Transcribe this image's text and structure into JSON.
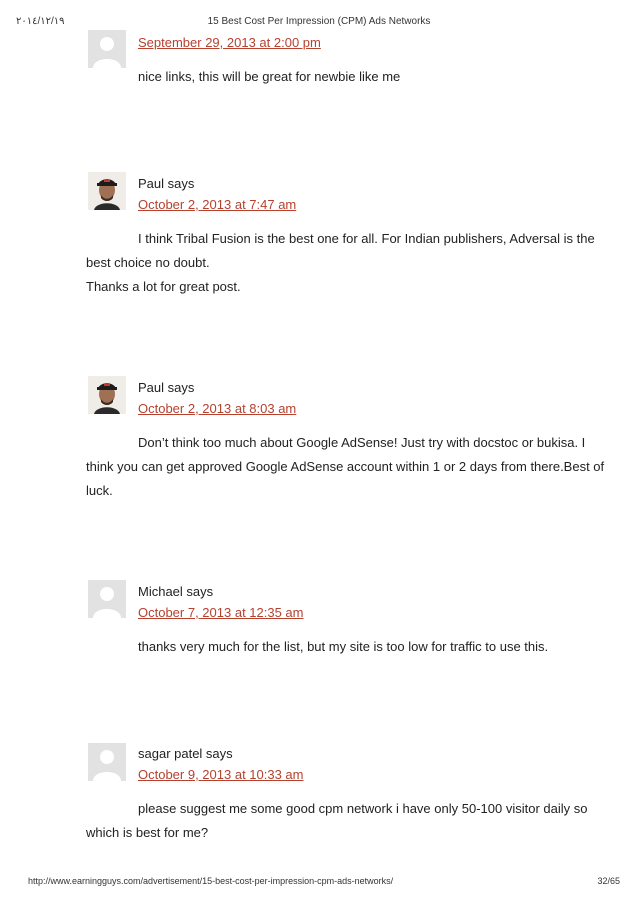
{
  "header": {
    "date": "٢٠١٤/١٢/١٩",
    "title": "15 Best Cost Per Impression (CPM) Ads Networks"
  },
  "comments": [
    {
      "author": "",
      "date": "September 29, 2013 at 2:00 pm",
      "text": [
        "nice links, this will be great for newbie like me"
      ],
      "avatar": "default-avatar-icon"
    },
    {
      "author": "Paul says",
      "date": "October 2, 2013 at 7:47 am",
      "text": [
        "I think Tribal Fusion is the best one for all. For Indian publishers, Adversal is the best choice no doubt.",
        "Thanks a lot for great post."
      ],
      "avatar": "user-photo"
    },
    {
      "author": "Paul says",
      "date": "October 2, 2013 at 8:03 am",
      "text": [
        "Don’t think too much about Google AdSense! Just try with docstoc or bukisa. I think you can get approved Google AdSense account within 1 or 2 days from there.Best of luck."
      ],
      "avatar": "user-photo"
    },
    {
      "author": "Michael says",
      "date": "October 7, 2013 at 12:35 am",
      "text": [
        "thanks very much for the list, but my site is too low for traffic to use this."
      ],
      "avatar": "default-avatar-icon"
    },
    {
      "author": "sagar patel says",
      "date": "October 9, 2013 at 10:33 am",
      "text": [
        "please suggest me some good cpm network i have only 50-100 visitor daily so which is best for me?"
      ],
      "avatar": "default-avatar-icon"
    }
  ],
  "footer": {
    "url": "http://www.earningguys.com/advertisement/15-best-cost-per-impression-cpm-ads-networks/",
    "page": "32/65"
  }
}
